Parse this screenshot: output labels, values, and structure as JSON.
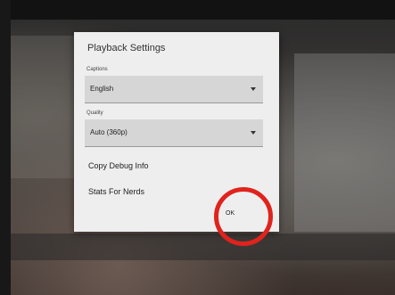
{
  "dialog": {
    "title": "Playback Settings",
    "captions": {
      "label": "Captions",
      "value": "English"
    },
    "quality": {
      "label": "Quality",
      "value": "Auto (360p)"
    },
    "items": [
      {
        "label": "Copy Debug Info"
      },
      {
        "label": "Stats For Nerds"
      }
    ],
    "ok_label": "OK"
  },
  "annotation": {
    "circle_color": "#e0231d"
  }
}
